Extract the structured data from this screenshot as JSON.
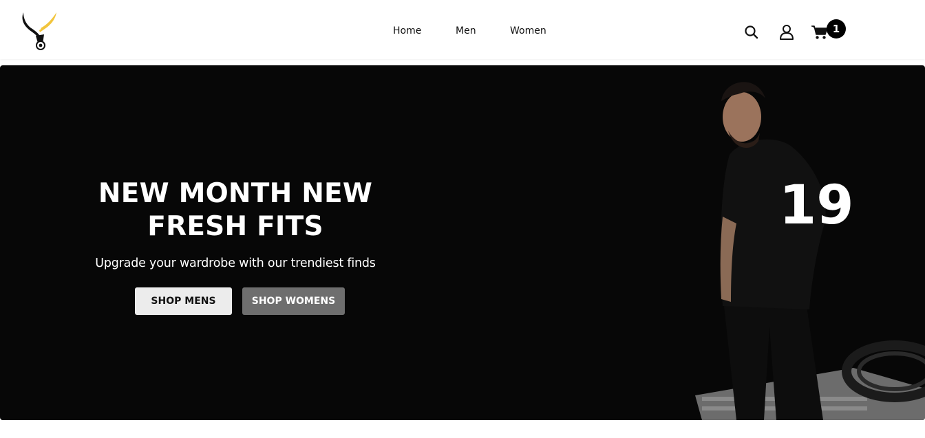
{
  "header": {
    "logo_name": "bull-horns-logo",
    "nav": [
      {
        "label": "Home"
      },
      {
        "label": "Men"
      },
      {
        "label": "Women"
      }
    ],
    "icons": {
      "search": "search-icon",
      "account": "user-icon",
      "cart": "cart-icon"
    },
    "cart_count": "1"
  },
  "hero": {
    "title_line1": "NEW MONTH NEW",
    "title_line2": "FRESH FITS",
    "subtitle": "Upgrade your wardrobe with our trendiest finds",
    "buttons": {
      "shop_mens": "SHOP MENS",
      "shop_womens": "SHOP WOMENS"
    },
    "shirt_number": "19"
  },
  "colors": {
    "logo_accent": "#f2c53d",
    "hero_bg": "#070707",
    "btn_men_bg": "#ececec",
    "btn_women_bg": "#6e6e6e",
    "badge_bg": "#000000"
  }
}
